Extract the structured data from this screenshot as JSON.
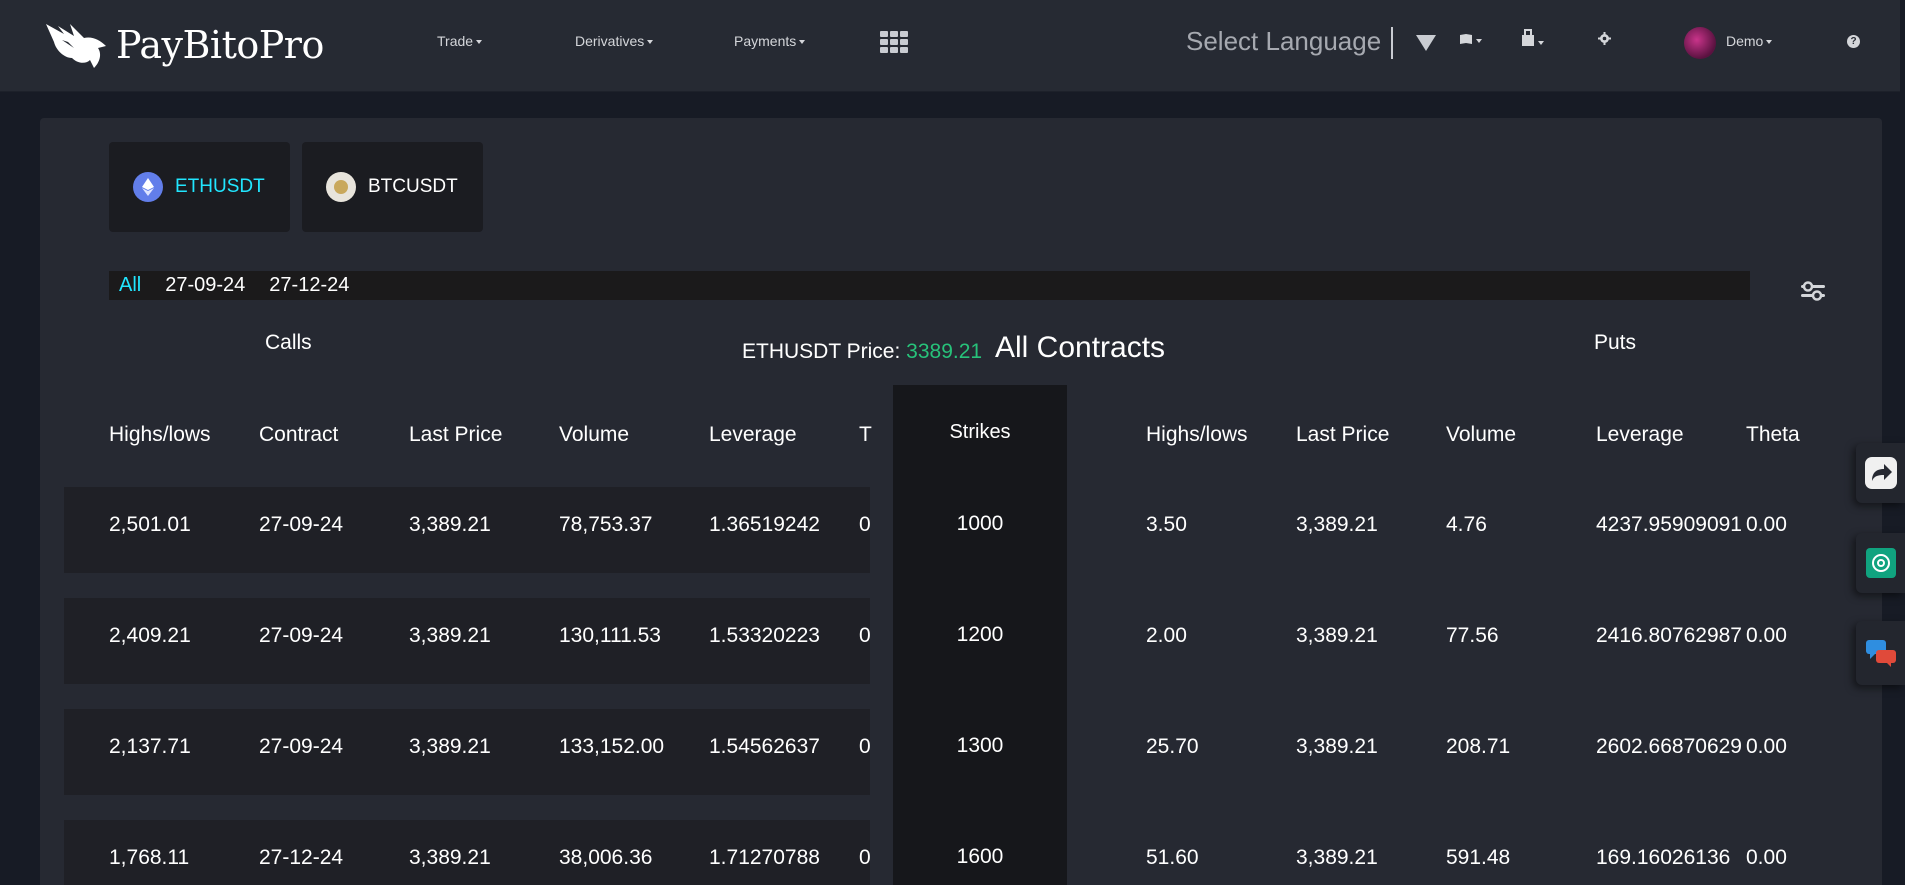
{
  "header": {
    "brand": "PayBitoPro",
    "nav": [
      {
        "label": "Trade"
      },
      {
        "label": "Derivatives"
      },
      {
        "label": "Payments"
      }
    ],
    "language": "Select Language",
    "user": "Demo"
  },
  "pairs": [
    {
      "label": "ETHUSDT",
      "active": true
    },
    {
      "label": "BTCUSDT",
      "active": false
    }
  ],
  "dates": [
    "All",
    "27-09-24",
    "27-12-24"
  ],
  "titles": {
    "calls": "Calls",
    "puts": "Puts",
    "price_label": "ETHUSDT Price:",
    "price_value": "3389.21",
    "all_contracts": "All Contracts"
  },
  "columns": {
    "calls": [
      "Highs/lows",
      "Contract",
      "Last Price",
      "Volume",
      "Leverage",
      "T"
    ],
    "strikes": "Strikes",
    "puts": [
      "Highs/lows",
      "Last Price",
      "Volume",
      "Leverage",
      "Theta"
    ]
  },
  "rows": [
    {
      "calls": [
        "2,501.01",
        "27-09-24",
        "3,389.21",
        "78,753.37",
        "1.36519242",
        "0"
      ],
      "strike": "1000",
      "puts": [
        "3.50",
        "3,389.21",
        "4.76",
        "4237.95909091",
        "0.00"
      ]
    },
    {
      "calls": [
        "2,409.21",
        "27-09-24",
        "3,389.21",
        "130,111.53",
        "1.53320223",
        "0"
      ],
      "strike": "1200",
      "puts": [
        "2.00",
        "3,389.21",
        "77.56",
        "2416.80762987",
        "0.00"
      ]
    },
    {
      "calls": [
        "2,137.71",
        "27-09-24",
        "3,389.21",
        "133,152.00",
        "1.54562637",
        "0"
      ],
      "strike": "1300",
      "puts": [
        "25.70",
        "3,389.21",
        "208.71",
        "2602.66870629",
        "0.00"
      ]
    },
    {
      "calls": [
        "1,768.11",
        "27-12-24",
        "3,389.21",
        "38,006.36",
        "1.71270788",
        "0"
      ],
      "strike": "1600",
      "puts": [
        "51.60",
        "3,389.21",
        "591.48",
        "169.16026136",
        "0.00"
      ]
    }
  ],
  "colors": {
    "accent": "#21e6ff",
    "price": "#27c27a",
    "panel": "#262932",
    "header": "#262a33"
  }
}
